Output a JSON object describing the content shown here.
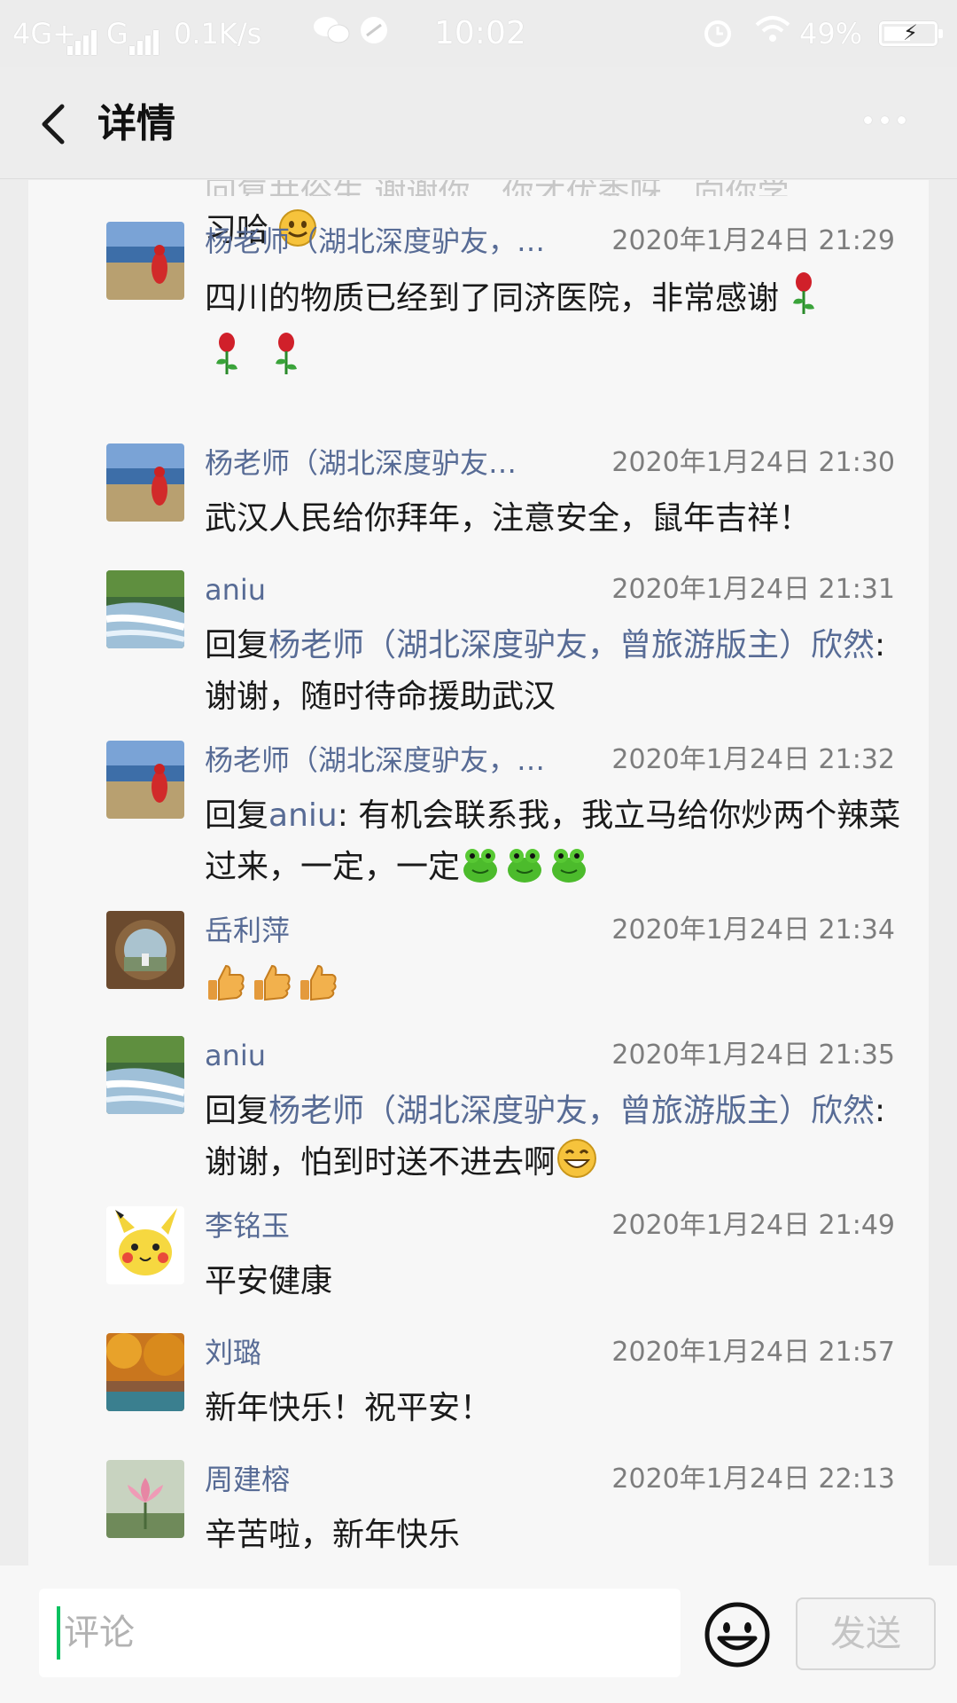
{
  "status_bar": {
    "network": "4G+",
    "network2": "G",
    "speed": "0.1K/s",
    "time": "10:02",
    "battery": "49%",
    "battery_level": 0.49
  },
  "header": {
    "title": "详情"
  },
  "partial_comment": {
    "line1": "回复井俗生  谢谢你，你才优秀呀，向你学",
    "line2": "习哈"
  },
  "comments": [
    {
      "name": "杨老师（湖北深度驴友，…",
      "time": "2020年1月24日 21:29",
      "text": "四川的物质已经到了同济医院，非常感谢",
      "avatar": "red-figure-lake"
    },
    {
      "name": "杨老师（湖北深度驴友…",
      "time": "2020年1月24日 21:30",
      "text": "武汉人民给你拜年，注意安全，鼠年吉祥！",
      "avatar": "red-figure-lake"
    },
    {
      "name": "aniu",
      "time": "2020年1月24日 21:31",
      "reply_prefix": "回复",
      "reply_to": "杨老师（湖北深度驴友，曾旅游版主）欣然",
      "text": ": 谢谢，随时待命援助武汉",
      "avatar": "waterfall"
    },
    {
      "name": "杨老师（湖北深度驴友，…",
      "time": "2020年1月24日 21:32",
      "reply_prefix": "回复",
      "reply_to": "aniu",
      "text": ": 有机会联系我，我立马给你炒两个辣菜过来，一定，一定",
      "avatar": "red-figure-lake"
    },
    {
      "name": "岳利萍",
      "time": "2020年1月24日 21:34",
      "text": "",
      "avatar": "stone-arch"
    },
    {
      "name": "aniu",
      "time": "2020年1月24日 21:35",
      "reply_prefix": "回复",
      "reply_to": "杨老师（湖北深度驴友，曾旅游版主）欣然",
      "text": ": 谢谢，怕到时送不进去啊",
      "avatar": "waterfall"
    },
    {
      "name": "李铭玉",
      "time": "2020年1月24日 21:49",
      "text": "平安健康",
      "avatar": "pikachu"
    },
    {
      "name": "刘璐",
      "time": "2020年1月24日 21:57",
      "text": "新年快乐！祝平安！",
      "avatar": "autumn-trees"
    },
    {
      "name": "周建榕",
      "time": "2020年1月24日 22:13",
      "text": "辛苦啦，新年快乐",
      "avatar": "lotus"
    }
  ],
  "input": {
    "placeholder": "评论",
    "send_label": "发送"
  },
  "icons": [
    "back-icon",
    "more-icon",
    "smile-face-icon",
    "rose-emoji",
    "thumbs-up-emoji",
    "frog-emoji",
    "grin-emoji",
    "smile-emoji"
  ],
  "colors": {
    "link": "#576b95",
    "accent": "#07c160",
    "background": "#ededed"
  }
}
